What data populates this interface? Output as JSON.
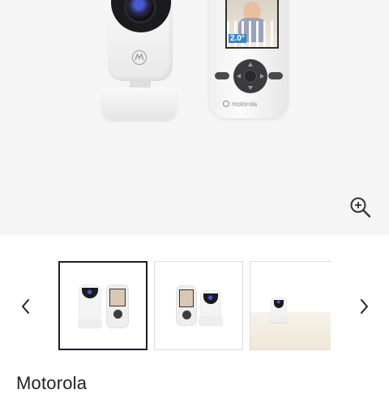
{
  "hero": {
    "temperature_display": "2.0°",
    "unit_brand_text": "motorola",
    "zoom_icon": "zoom-in-icon"
  },
  "gallery": {
    "prev_icon": "chevron-left-icon",
    "next_icon": "chevron-right-icon",
    "selected_index": 0,
    "thumbnails": [
      {
        "id": "thumb-1",
        "content": "camera-and-parent-unit-front"
      },
      {
        "id": "thumb-2",
        "content": "parent-unit-and-camera-angled"
      },
      {
        "id": "thumb-3",
        "content": "camera-in-room"
      }
    ]
  },
  "product": {
    "brand": "Motorola"
  },
  "colors": {
    "selected_border": "#1d1d2c",
    "hero_background": "#f5f5f5",
    "text": "#222222"
  }
}
